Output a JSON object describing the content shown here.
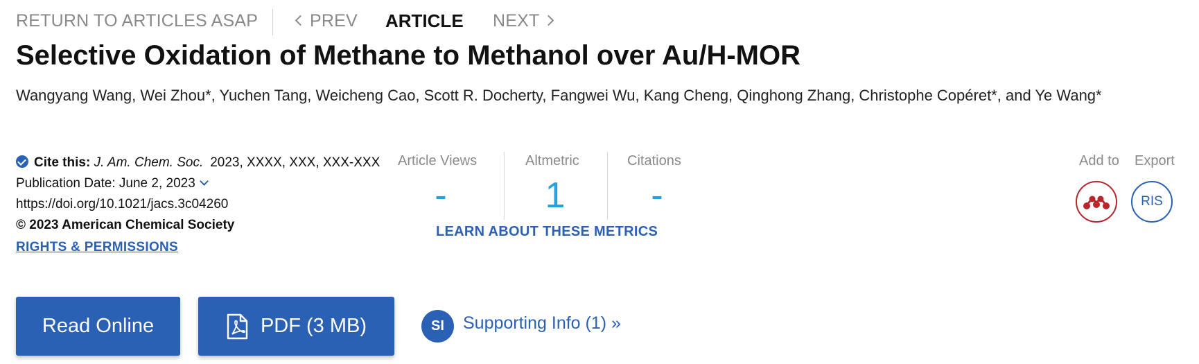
{
  "nav": {
    "return_label": "RETURN TO ARTICLES ASAP",
    "prev_label": "PREV",
    "current_label": "ARTICLE",
    "next_label": "NEXT"
  },
  "article": {
    "title": "Selective Oxidation of Methane to Methanol over Au/H-MOR",
    "authors": "Wangyang Wang, Wei Zhou*, Yuchen Tang, Weicheng Cao, Scott R. Docherty, Fangwei Wu, Kang Cheng, Qinghong Zhang, Christophe Copéret*, and Ye Wang*"
  },
  "citation": {
    "label": "Cite this:",
    "journal": "J. Am. Chem. Soc.",
    "details": "2023, XXXX, XXX, XXX-XXX",
    "publication_date": "Publication Date: June 2, 2023",
    "doi": "https://doi.org/10.1021/jacs.3c04260",
    "copyright": "© 2023 American Chemical Society",
    "rights_link": "RIGHTS & PERMISSIONS"
  },
  "metrics": {
    "views_label": "Article Views",
    "views_value": "-",
    "altmetric_label": "Altmetric",
    "altmetric_value": "1",
    "citations_label": "Citations",
    "citations_value": "-",
    "learn_link": "LEARN ABOUT THESE METRICS"
  },
  "actions": {
    "add_to_label": "Add to",
    "export_label": "Export",
    "ris_label": "RIS",
    "read_online_label": "Read Online",
    "pdf_label": "PDF (3 MB)",
    "si_badge": "SI",
    "supporting_info_label": "Supporting Info (1) »"
  },
  "icons": {
    "cite": "check-circle-icon",
    "mendeley": "mendeley-icon",
    "pdf": "pdf-file-icon"
  },
  "colors": {
    "brand_blue": "#2a61b5",
    "metric_blue": "#26a0d9",
    "mendeley_red": "#b8262c",
    "muted_gray": "#8a8a8a"
  }
}
